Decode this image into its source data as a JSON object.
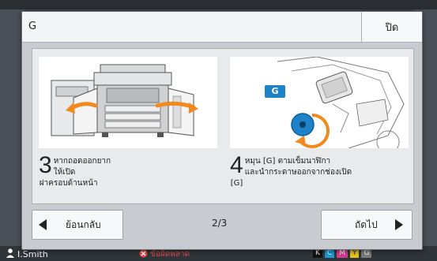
{
  "dialog": {
    "title": "G",
    "close_label": "ปิด"
  },
  "steps": [
    {
      "number": "3",
      "text": "หากถอดออกยาก\nให้เปิด\nฝาครอบด้านหน้า"
    },
    {
      "number": "4",
      "text": "หมุน [G] ตามเข็มนาฬิกา\nและนำกระดาษออกจากช่องเปิด\n[G]"
    }
  ],
  "illustration_badge": "G",
  "footer": {
    "back_label": "ย้อนกลับ",
    "page_indicator": "2/3",
    "next_label": "ถัดไป"
  },
  "status_bar": {
    "user": "I.Smith",
    "error_text": "ข้อผิดพลาด",
    "toner": [
      "K",
      "C",
      "M",
      "Y",
      "G"
    ]
  },
  "colors": {
    "dialog_bg": "#c8cbcf",
    "accent_blue": "#1e82c8",
    "orange_arrow": "#f08a1e",
    "error_red": "#e24a4a"
  }
}
